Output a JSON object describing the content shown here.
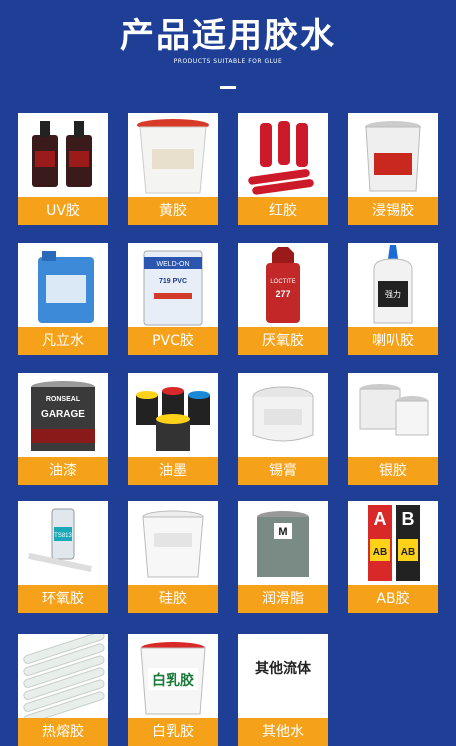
{
  "header": {
    "title": "产品适用胶水",
    "subtitle": "PRODUCTS SUITABLE FOR GLUE"
  },
  "products": [
    {
      "label": "UV胶",
      "icon": "uv-glue-bottles-image"
    },
    {
      "label": "黄胶",
      "icon": "yellow-glue-bucket-image"
    },
    {
      "label": "红胶",
      "icon": "red-glue-syringes-image"
    },
    {
      "label": "浸锡胶",
      "icon": "tin-dipping-glue-bucket-image"
    },
    {
      "label": "凡立水",
      "icon": "varnish-canister-image"
    },
    {
      "label": "PVC胶",
      "icon": "pvc-glue-can-image",
      "can_text": "WELD-ON",
      "can_sub": "719 PVC"
    },
    {
      "label": "厌氧胶",
      "icon": "anaerobic-glue-bottle-image",
      "bottle_text": "LOCTITE",
      "bottle_sub": "277"
    },
    {
      "label": "喇叭胶",
      "icon": "speaker-glue-bottle-image",
      "bottle_text": "强力"
    },
    {
      "label": "油漆",
      "icon": "paint-can-image",
      "can_text": "RONSEAL",
      "can_sub": "GARAGE"
    },
    {
      "label": "油墨",
      "icon": "ink-cans-image"
    },
    {
      "label": "锡膏",
      "icon": "solder-paste-jar-image"
    },
    {
      "label": "银胶",
      "icon": "silver-glue-jars-image"
    },
    {
      "label": "环氧胶",
      "icon": "epoxy-cartridge-image",
      "cartridge_text": "TS813"
    },
    {
      "label": "硅胶",
      "icon": "silicone-bucket-image"
    },
    {
      "label": "润滑脂",
      "icon": "grease-can-image",
      "can_letter": "M"
    },
    {
      "label": "AB胶",
      "icon": "ab-glue-packs-image",
      "pack_a": "A",
      "pack_b": "B",
      "pack_text": "AB"
    },
    {
      "label": "热熔胶",
      "icon": "hot-melt-sticks-image"
    },
    {
      "label": "白乳胶",
      "icon": "white-latex-bucket-image",
      "bucket_text": "白乳胶"
    },
    {
      "label": "其他水",
      "icon": "other-text-tile",
      "tile_text": "其他流体"
    }
  ],
  "colors": {
    "background": "#1e3f95",
    "label_bg": "#f5a21a",
    "card_bg": "#ffffff"
  }
}
